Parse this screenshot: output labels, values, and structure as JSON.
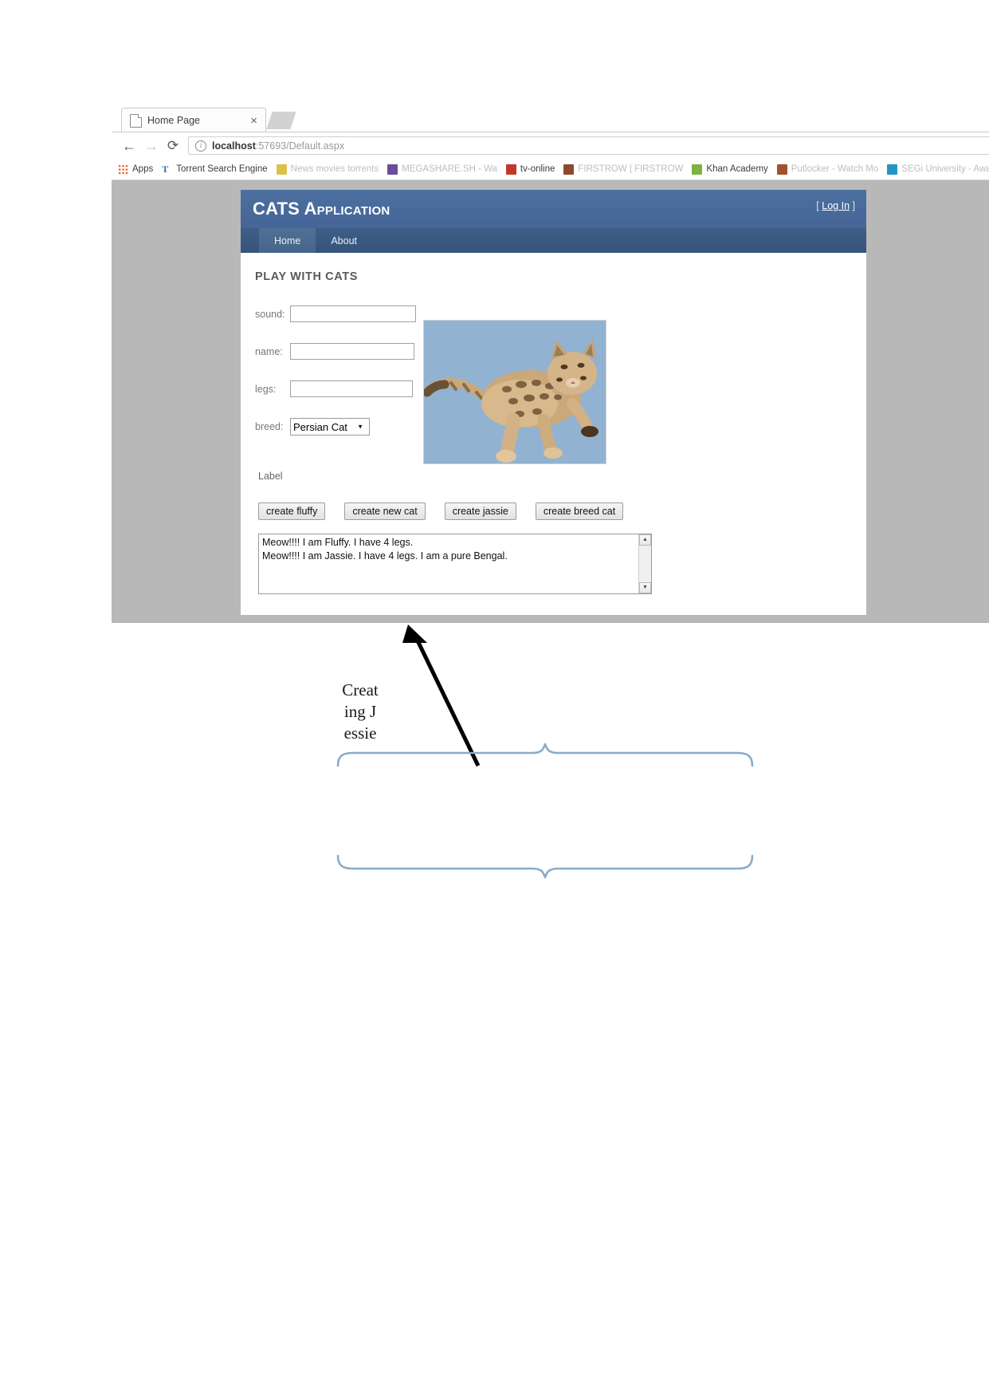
{
  "browser": {
    "tab": {
      "title": "Home Page",
      "close_label": "×",
      "favicon": "document-icon"
    },
    "nav": {
      "back": "←",
      "forward": "→",
      "reload": "⟳"
    },
    "omnibox": {
      "info_glyph": "i",
      "url_host": "localhost",
      "url_rest": ":57693/Default.aspx",
      "url_full": "localhost:57693/Default.aspx"
    },
    "bookmarks": [
      {
        "label": "Apps",
        "icon": "apps-grid-icon",
        "faded": false
      },
      {
        "label": "Torrent Search Engine",
        "icon": "torrent-icon",
        "faded": false
      },
      {
        "label": "News movies torrents",
        "icon": "shield-icon",
        "faded": true
      },
      {
        "label": "MEGASHARE.SH - Wa",
        "icon": "film-icon",
        "faded": true
      },
      {
        "label": "tv-online",
        "icon": "tv-icon",
        "faded": false
      },
      {
        "label": "FIRSTROW | FIRSTROW",
        "icon": "firstrow-icon",
        "faded": true
      },
      {
        "label": "Khan Academy",
        "icon": "leaf-icon",
        "faded": false
      },
      {
        "label": "Putlocker - Watch Mo",
        "icon": "film-strip-icon",
        "faded": true
      },
      {
        "label": "SEGi University - Awa",
        "icon": "university-icon",
        "faded": true
      }
    ]
  },
  "site": {
    "title": "CATS Application",
    "login": {
      "open_bracket": "[",
      "link": "Log In",
      "close_bracket": "]"
    },
    "nav_tabs": [
      {
        "label": "Home",
        "active": true
      },
      {
        "label": "About",
        "active": false
      }
    ],
    "heading": "PLAY WITH CATS",
    "fields": [
      {
        "label": "sound:",
        "value": "",
        "placeholder": ""
      },
      {
        "label": "name:",
        "value": "",
        "placeholder": ""
      },
      {
        "label": "legs:",
        "value": "",
        "placeholder": ""
      }
    ],
    "breed": {
      "label": "breed:",
      "selected": "Persian Cat",
      "arrow": "▼",
      "options": [
        "Persian Cat"
      ]
    },
    "status_label": "Label",
    "buttons": [
      {
        "label": "create fluffy"
      },
      {
        "label": "create new cat"
      },
      {
        "label": "create jassie"
      },
      {
        "label": "create breed cat"
      }
    ],
    "output": {
      "lines": [
        "Meow!!!! I am Fluffy. I have 4 legs.",
        "Meow!!!! I am Jassie. I have 4 legs. I am a pure Bengal."
      ],
      "text": "Meow!!!! I am Fluffy. I have 4 legs.\nMeow!!!! I am Jassie. I have 4 legs. I am a pure Bengal.",
      "scroll_up": "▲",
      "scroll_down": "▼"
    },
    "photo_alt": "bengal-cat-photo"
  },
  "annotation": {
    "callout_text": "Creating Jessie",
    "brace_color": "#8aabc8",
    "arrow_color": "#000000"
  },
  "colors": {
    "header_blue": "#4a6e9e",
    "navbar_blue": "#3b5980",
    "viewport_gray": "#b8b8b8",
    "brace_blue": "#8aabc8"
  }
}
